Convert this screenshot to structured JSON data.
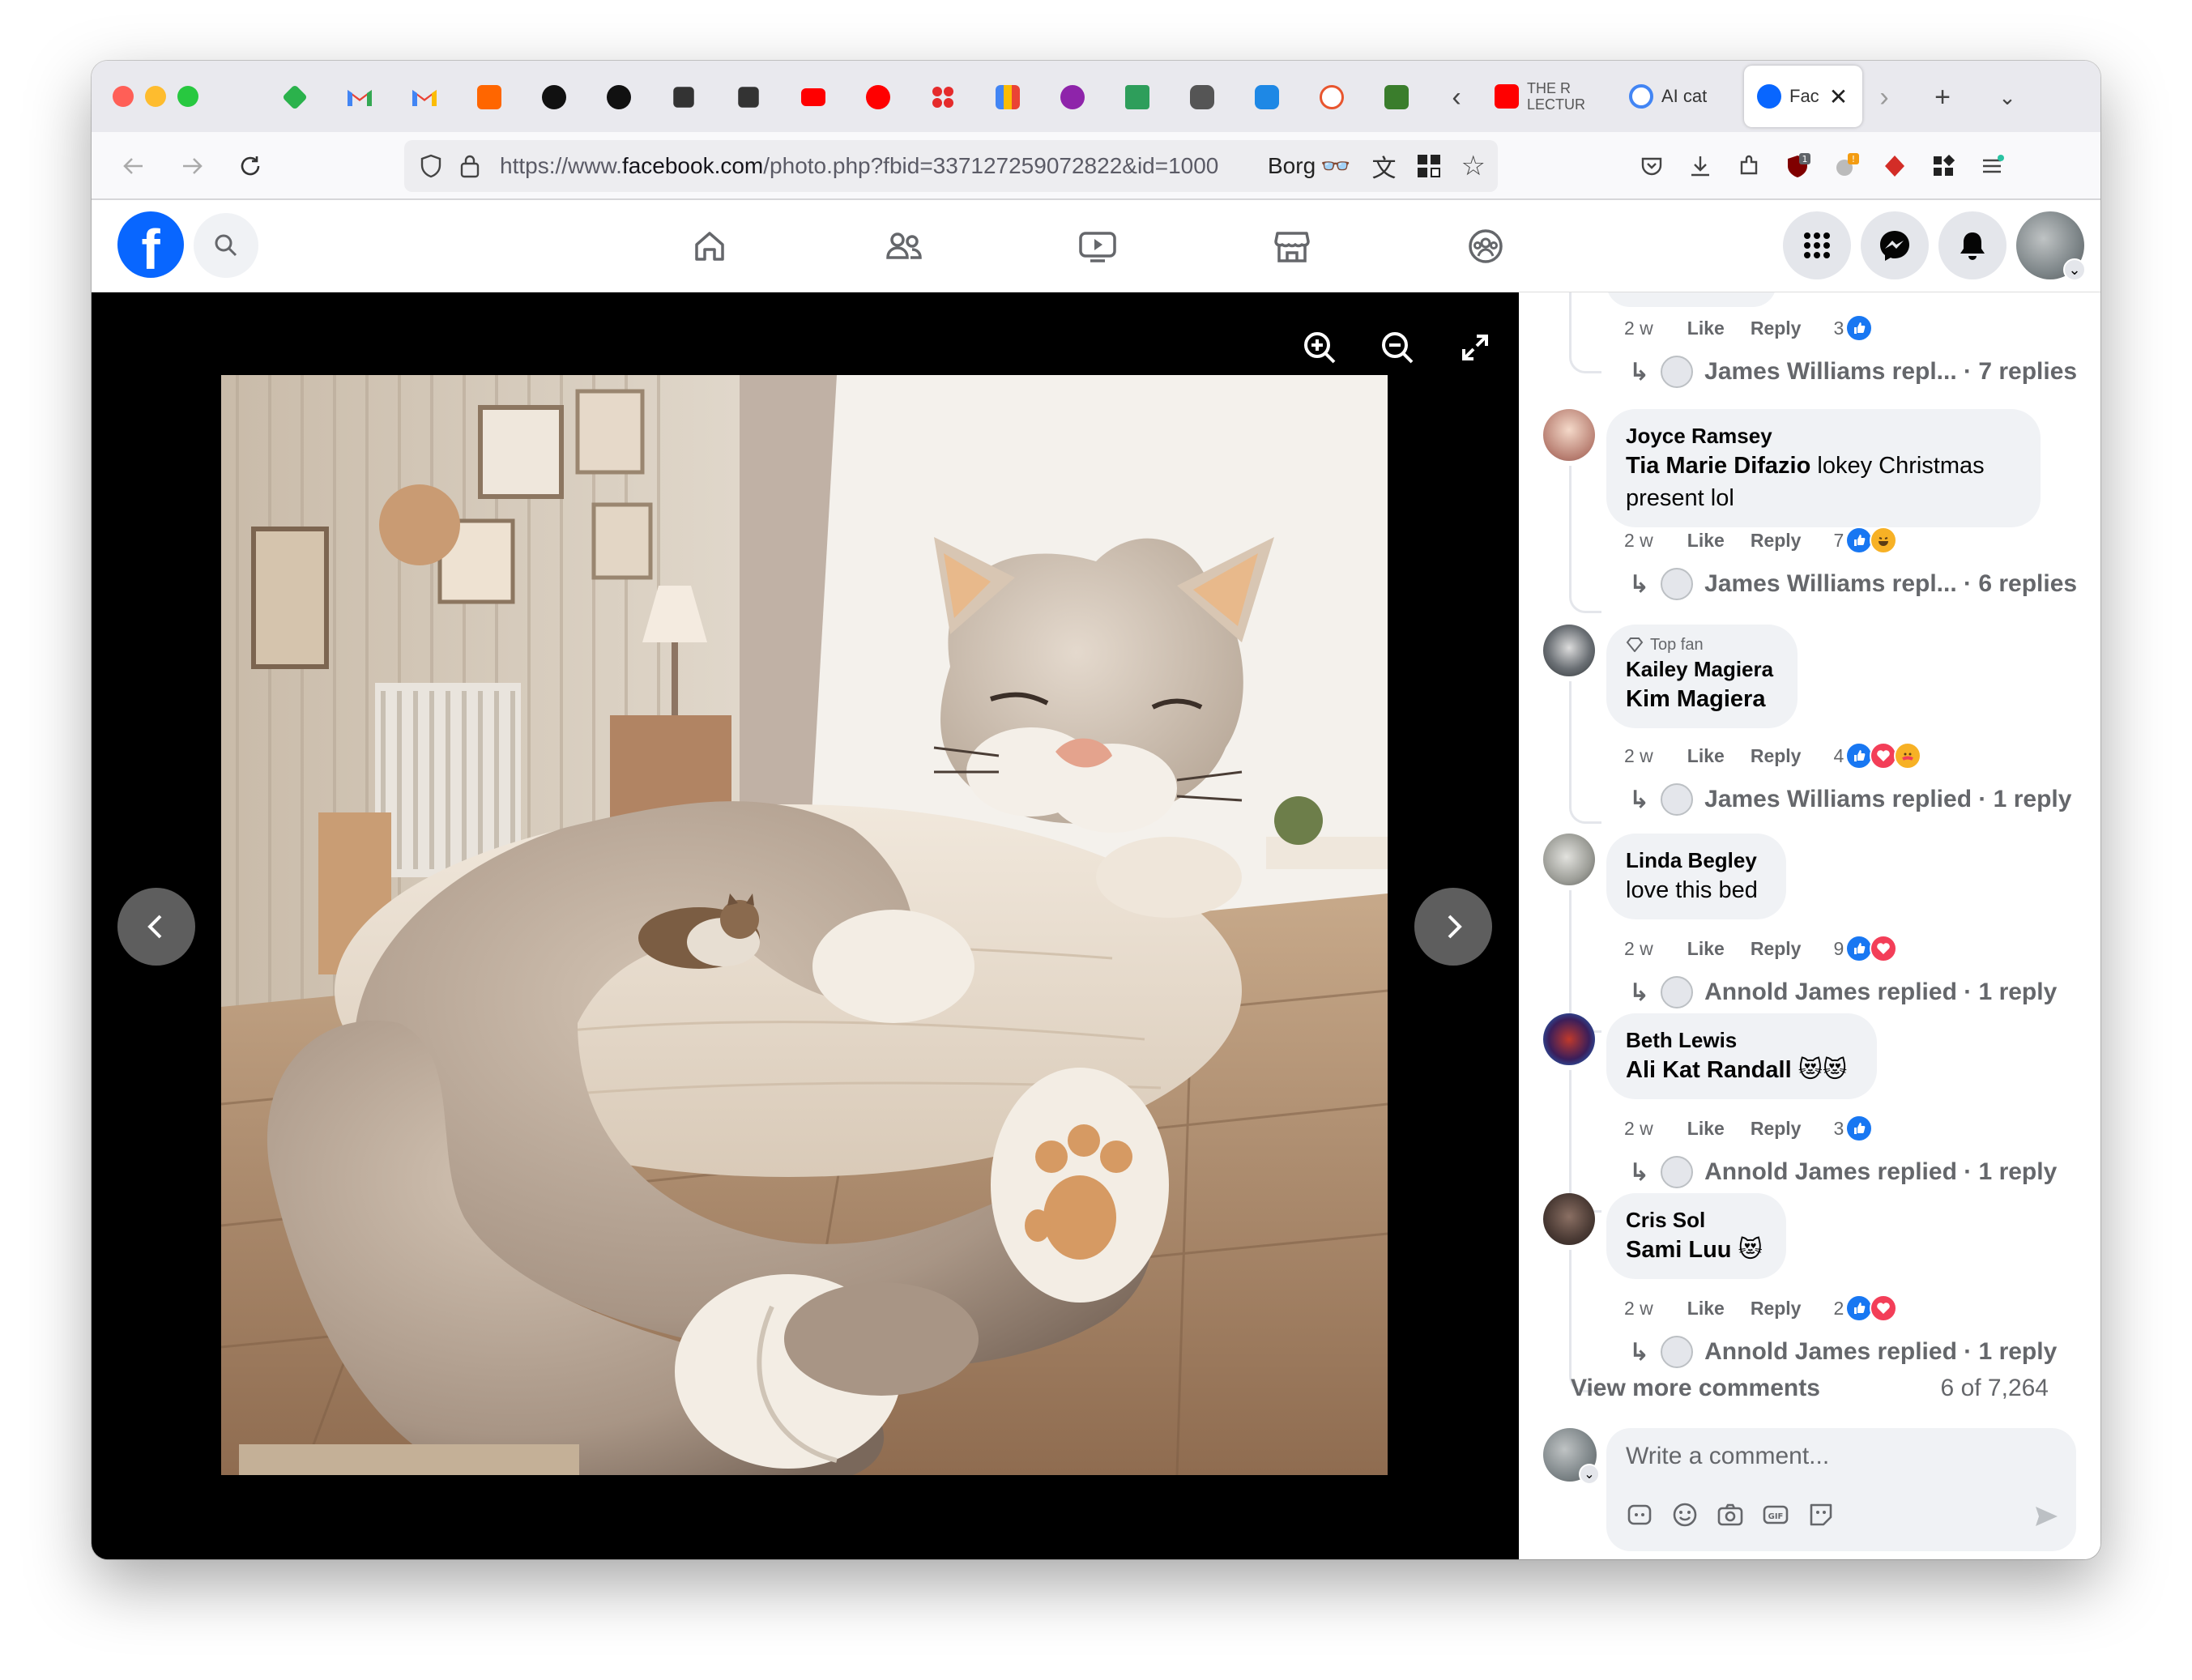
{
  "browser": {
    "tabs": [
      {
        "label": "THE R LECTUR",
        "favicon_color": "#ff0000"
      },
      {
        "label": "AI cat",
        "favicon_color": "#4285f4"
      },
      {
        "label": "Fac",
        "favicon_color": "#0866ff",
        "active": true
      }
    ],
    "url": {
      "prefix": "https://www.",
      "host": "facebook.com",
      "path": "/photo.php?fbid=337127259072822&id=1000"
    },
    "toolbar_text": "Borg"
  },
  "photo": {
    "description_alt": "Giant plush cat-shaped bed with a small cat lying on the mattress"
  },
  "comments": [
    {
      "meta": {
        "time": "2 w",
        "like": "Like",
        "reply": "Reply",
        "count": "3"
      },
      "replies": "James Williams repl... · 7 replies"
    },
    {
      "author": "Joyce Ramsey",
      "tag": "Tia Marie Difazio",
      "text": " lokey Christmas present lol",
      "meta": {
        "time": "2 w",
        "like": "Like",
        "reply": "Reply",
        "count": "7"
      },
      "replies": "James Williams repl... · 6 replies"
    },
    {
      "badge": "Top fan",
      "author": "Kailey Magiera",
      "tag": "Kim Magiera",
      "text": "",
      "meta": {
        "time": "2 w",
        "like": "Like",
        "reply": "Reply",
        "count": "4"
      },
      "replies": "James Williams replied · 1 reply"
    },
    {
      "author": "Linda Begley",
      "tag": "",
      "text": "love this bed",
      "meta": {
        "time": "2 w",
        "like": "Like",
        "reply": "Reply",
        "count": "9"
      },
      "replies": "Annold James replied · 1 reply"
    },
    {
      "author": "Beth Lewis",
      "tag": "Ali Kat Randall",
      "text": " 😻😻",
      "meta": {
        "time": "2 w",
        "like": "Like",
        "reply": "Reply",
        "count": "3"
      },
      "replies": "Annold James replied · 1 reply"
    },
    {
      "author": "Cris Sol",
      "tag": "Sami Luu",
      "text": " 😻",
      "meta": {
        "time": "2 w",
        "like": "Like",
        "reply": "Reply",
        "count": "2"
      },
      "replies": "Annold James replied · 1 reply"
    }
  ],
  "view_more": "View more comments",
  "comment_count": "6 of 7,264",
  "composer": {
    "placeholder": "Write a comment..."
  },
  "colors": {
    "facebook_blue": "#0866ff",
    "like_blue": "#1877f2",
    "love_red": "#f33e58"
  }
}
